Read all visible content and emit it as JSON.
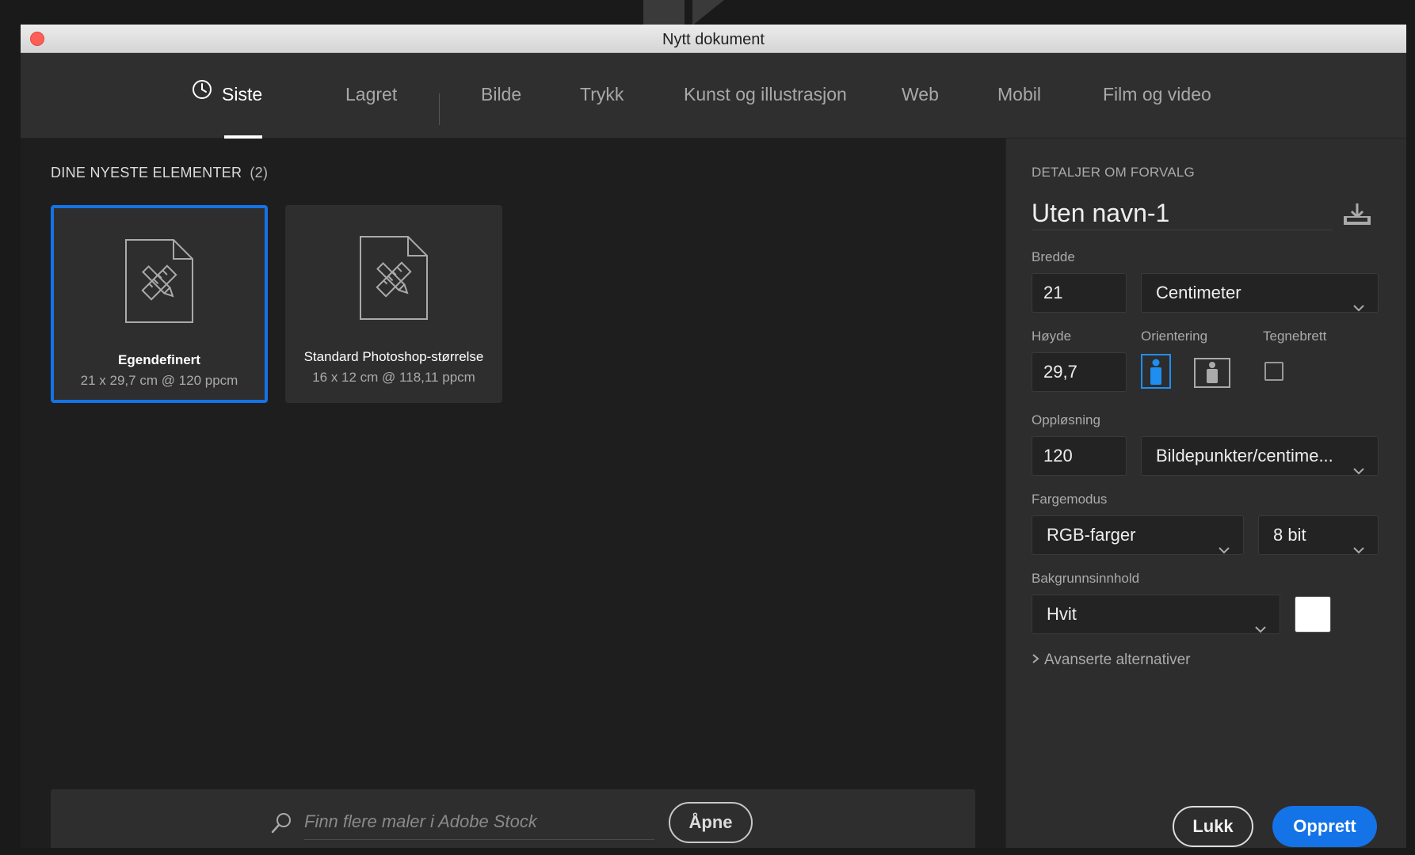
{
  "window": {
    "title": "Nytt dokument"
  },
  "tabs": [
    {
      "label": "Siste",
      "icon": "clock-icon",
      "active": true
    },
    {
      "label": "Lagret"
    },
    {
      "label": "Bilde"
    },
    {
      "label": "Trykk"
    },
    {
      "label": "Kunst og illustrasjon"
    },
    {
      "label": "Web"
    },
    {
      "label": "Mobil"
    },
    {
      "label": "Film og video"
    }
  ],
  "recent": {
    "title": "DINE NYESTE ELEMENTER",
    "count": "(2)",
    "items": [
      {
        "name": "Egendefinert",
        "desc": "21 x 29,7 cm @ 120 ppcm",
        "selected": true,
        "icon": "document-ruler-pencil-icon"
      },
      {
        "name": "Standard Photoshop-størrelse",
        "desc": "16 x 12 cm @ 118,11 ppcm",
        "selected": false,
        "icon": "document-ruler-pencil-icon"
      }
    ]
  },
  "stock": {
    "placeholder": "Finn flere maler i Adobe Stock",
    "open_label": "Åpne",
    "icon": "search-icon"
  },
  "details": {
    "title": "DETALJER OM FORVALG",
    "preset_name": "Uten navn-1",
    "save_icon": "save-preset-icon",
    "width_label": "Bredde",
    "width_value": "21",
    "unit": "Centimeter",
    "height_label": "Høyde",
    "height_value": "29,7",
    "orientation_label": "Orientering",
    "orientation_selected": "portrait",
    "artboard_label": "Tegnebrett",
    "artboard_checked": false,
    "resolution_label": "Oppløsning",
    "resolution_value": "120",
    "resolution_unit": "Bildepunkter/centime...",
    "color_mode_label": "Fargemodus",
    "color_mode": "RGB-farger",
    "bit_depth": "8 bit",
    "background_label": "Bakgrunnsinnhold",
    "background": "Hvit",
    "background_color": "#ffffff",
    "advanced_label": "Avanserte alternativer"
  },
  "actions": {
    "close_label": "Lukk",
    "create_label": "Opprett"
  },
  "colors": {
    "accent": "#1473e6",
    "close_dot": "#fc5f57",
    "panel_bg": "#2d2d2d",
    "main_bg": "#1e1e1e"
  }
}
